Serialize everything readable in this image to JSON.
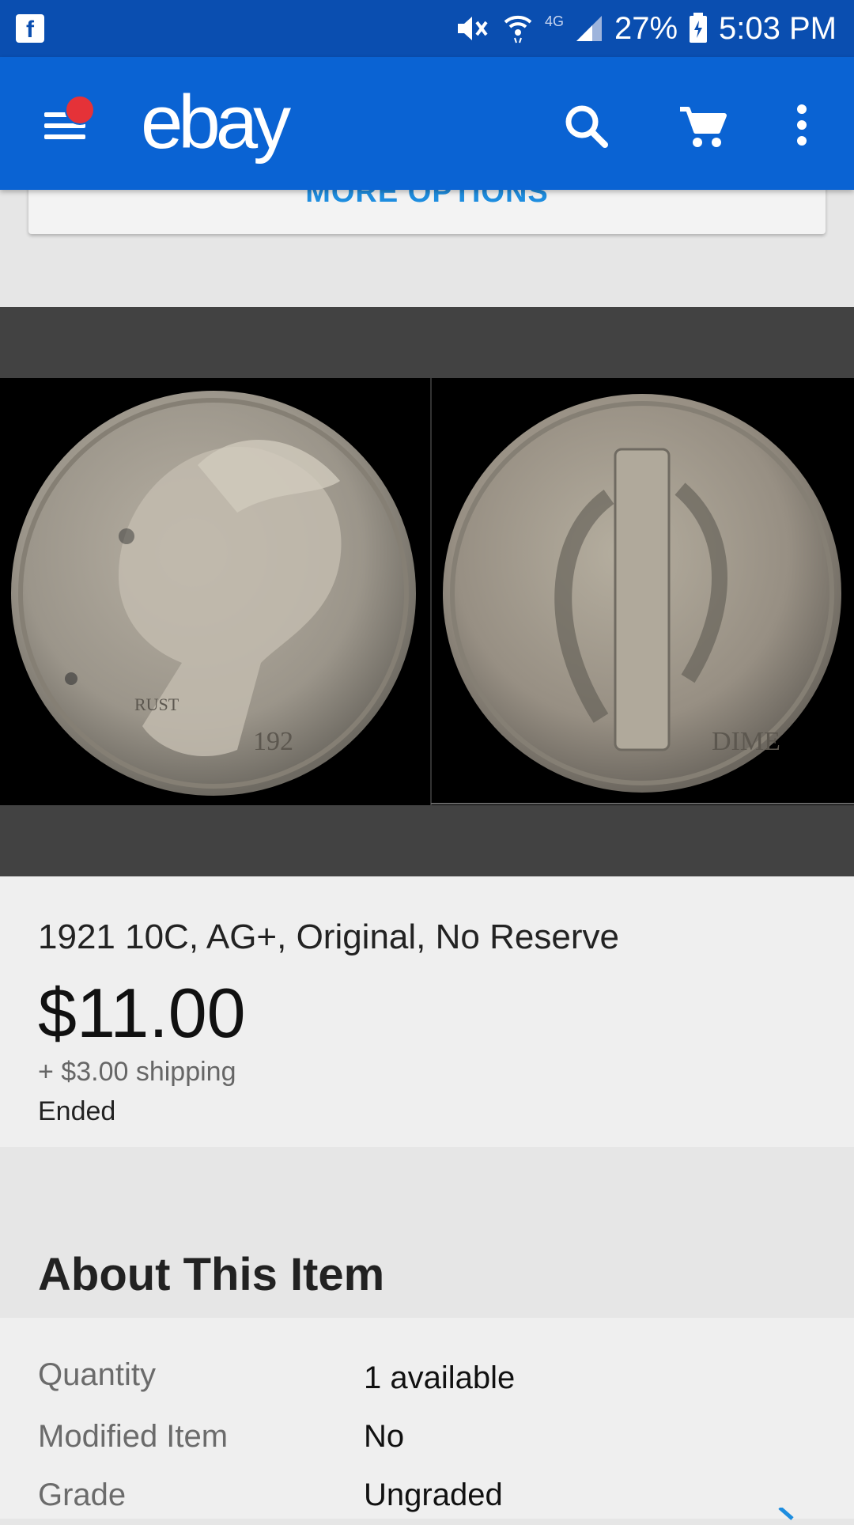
{
  "status_bar": {
    "battery": "27%",
    "time": "5:03 PM",
    "network": "4G"
  },
  "app_bar": {
    "logo": "ebay",
    "icons": [
      "menu-icon",
      "search-icon",
      "cart-icon",
      "more-vert-icon"
    ],
    "brand_color": "#0a63d3"
  },
  "more_options": {
    "label": "MORE OPTIONS"
  },
  "listing": {
    "title": "1921 10C, AG+, Original, No Reserve",
    "price": "$11.00",
    "shipping": "+ $3.00 shipping",
    "status": "Ended"
  },
  "about": {
    "heading": "About This Item",
    "rows": [
      {
        "label": "Quantity",
        "value": "1 available"
      },
      {
        "label": "Modified Item",
        "value": "No"
      },
      {
        "label": "Grade",
        "value": "Ungraded"
      }
    ]
  },
  "colors": {
    "link": "#1e8ddf",
    "notification_dot": "#e53238"
  }
}
